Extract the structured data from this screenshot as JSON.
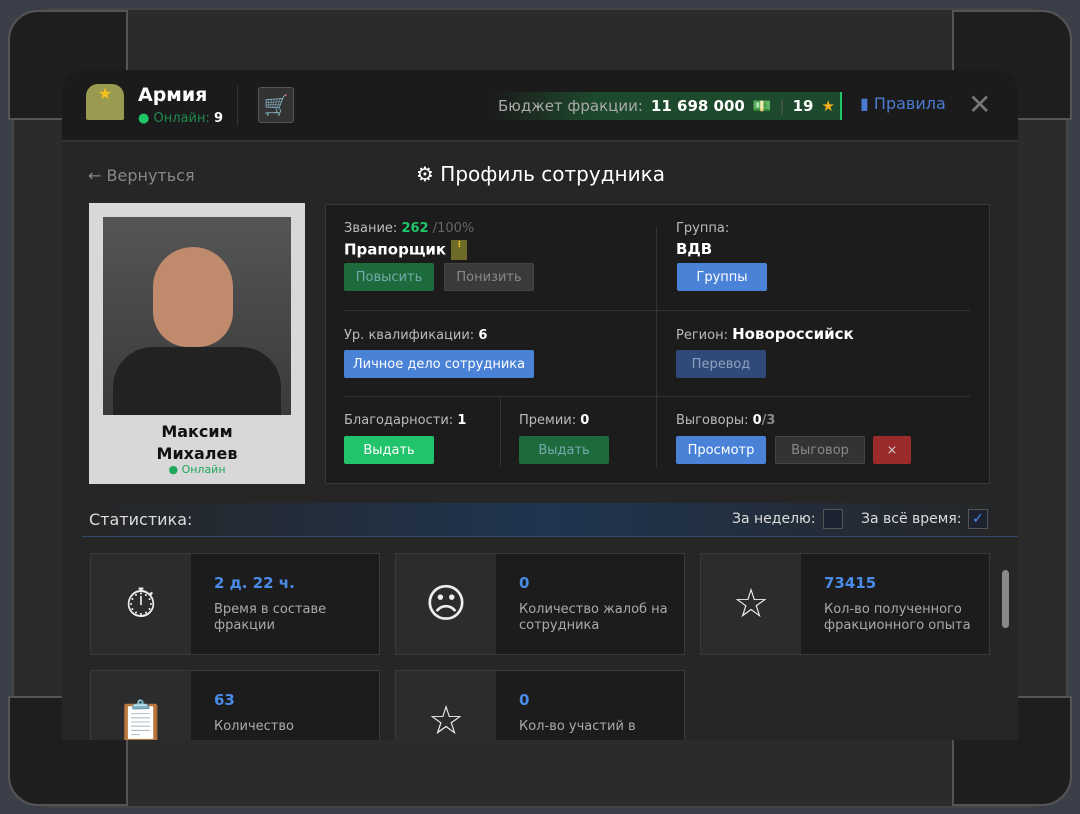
{
  "header": {
    "faction_name": "Армия",
    "online_label": "Онлайн:",
    "online_count": "9",
    "budget_label": "Бюджет фракции:",
    "budget_value": "11 698 000",
    "stars": "19",
    "rules_label": "Правила"
  },
  "nav": {
    "back_label": "Вернуться",
    "page_title": "Профиль сотрудника"
  },
  "employee": {
    "name_first": "Максим",
    "name_last": "Михалев",
    "status": "Онлайн"
  },
  "profile": {
    "rank_label": "Звание:",
    "rank_points": "262",
    "rank_max": "/100%",
    "rank_name": "Прапорщик",
    "promote": "Повысить",
    "demote": "Понизить",
    "group_label": "Группа:",
    "group_value": "ВДВ",
    "groups_btn": "Группы",
    "qual_label": "Ур. квалификации:",
    "qual_value": "6",
    "personal_file_btn": "Личное дело сотрудника",
    "region_label": "Регион:",
    "region_value": "Новороссийск",
    "transfer_btn": "Перевод",
    "thanks_label": "Благодарности:",
    "thanks_value": "1",
    "thanks_btn": "Выдать",
    "bonus_label": "Премии:",
    "bonus_value": "0",
    "bonus_btn": "Выдать",
    "reprimand_label": "Выговоры:",
    "reprimand_value": "0",
    "reprimand_max": "/3",
    "view_btn": "Просмотр",
    "reprimand_btn": "Выговор"
  },
  "stats": {
    "title": "Статистика:",
    "week_label": "За неделю:",
    "week_checked": false,
    "all_label": "За всё время:",
    "all_checked": true,
    "cards": [
      {
        "icon": "stopwatch-icon",
        "value": "2 д. 22 ч.",
        "label": "Время в составе фракции"
      },
      {
        "icon": "complaint-icon",
        "value": "0",
        "label": "Количество жалоб на сотрудника"
      },
      {
        "icon": "exp-stars-icon",
        "value": "73415",
        "label": "Кол-во полученного фракционного опыта"
      },
      {
        "icon": "clipboard-icon",
        "value": "63",
        "label": "Количество"
      },
      {
        "icon": "star-icon",
        "value": "0",
        "label": "Кол-во участий в"
      }
    ]
  },
  "colors": {
    "green": "#1fc769",
    "blue": "#4a82d8",
    "red": "#9b2a2a",
    "budget_bg": "#1d4a2c"
  }
}
